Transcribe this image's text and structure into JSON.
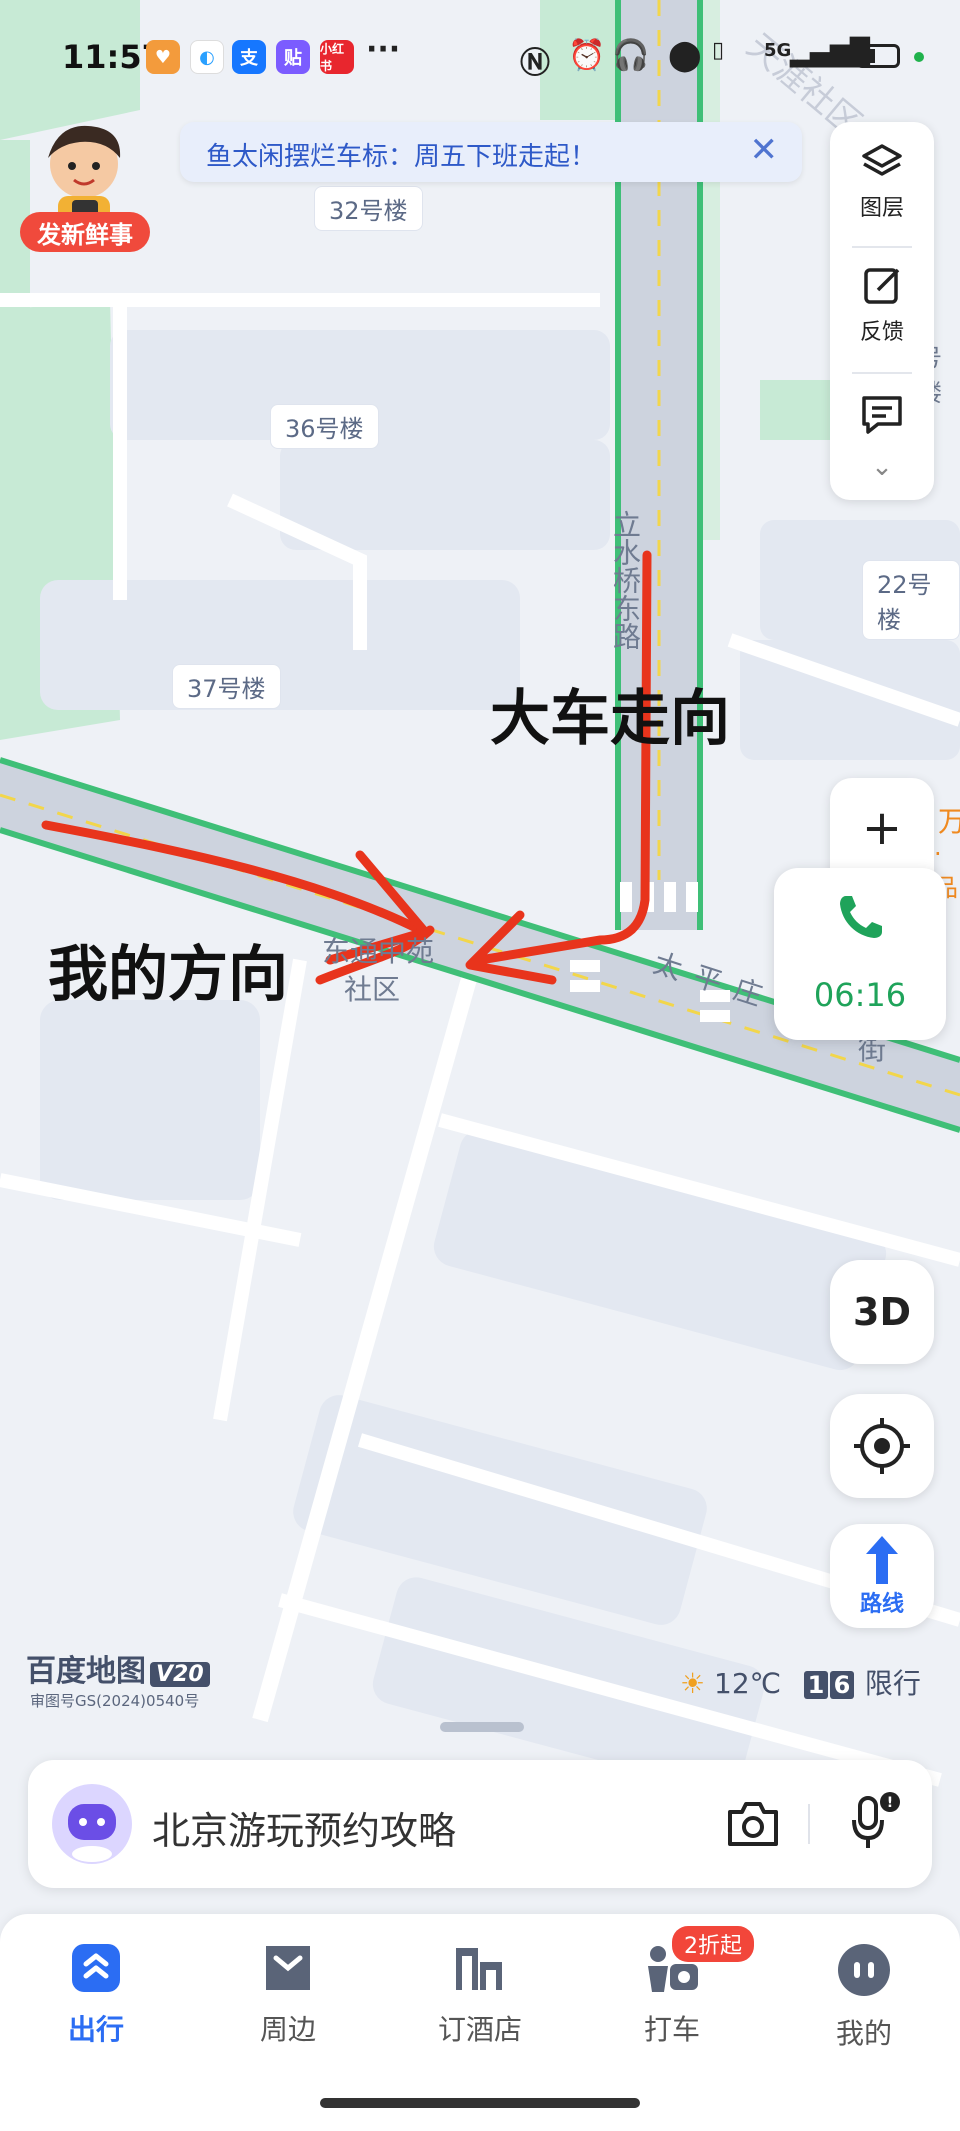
{
  "status_bar": {
    "time": "11:57",
    "more": "···",
    "network": "5G"
  },
  "banner": {
    "text": "鱼太闲摆烂车标：周五下班走起！",
    "close": "✕"
  },
  "mascot": {
    "tag": "发新鲜事"
  },
  "right_panel": {
    "layers_label": "图层",
    "feedback_label": "反馈"
  },
  "map": {
    "buildings": [
      "32号楼",
      "36号楼",
      "37号楼",
      "22号楼"
    ],
    "road_vertical": "立水桥东路",
    "road_horizontal": "太平庄",
    "road_horizontal_suffix": "街",
    "community": "东通中苑",
    "community_2": "社区",
    "edge_label_1": "万",
    "edge_label_2": "·品",
    "edge_label_3": "号楼",
    "annotations": {
      "truck": "大车走向",
      "mine": "我的方向"
    }
  },
  "controls": {
    "zoom_in": "+",
    "call_time": "06:16",
    "btn_3d": "3D",
    "route_label": "路线"
  },
  "footer_info": {
    "logo": "百度地图",
    "logo_version": "V20",
    "reg_no": "审图号GS(2024)0540号",
    "temperature": "12℃",
    "limit_digits": [
      "1",
      "6"
    ],
    "limit_label": "限行"
  },
  "search": {
    "placeholder": "北京游玩预约攻略"
  },
  "nav": {
    "items": [
      {
        "label": "出行",
        "icon": "go-icon"
      },
      {
        "label": "周边",
        "icon": "nearby-icon"
      },
      {
        "label": "订酒店",
        "icon": "hotel-icon"
      },
      {
        "label": "打车",
        "icon": "taxi-icon"
      },
      {
        "label": "我的",
        "icon": "profile-icon"
      }
    ],
    "taxi_badge": "2折起"
  },
  "watermark": "天涯社区"
}
